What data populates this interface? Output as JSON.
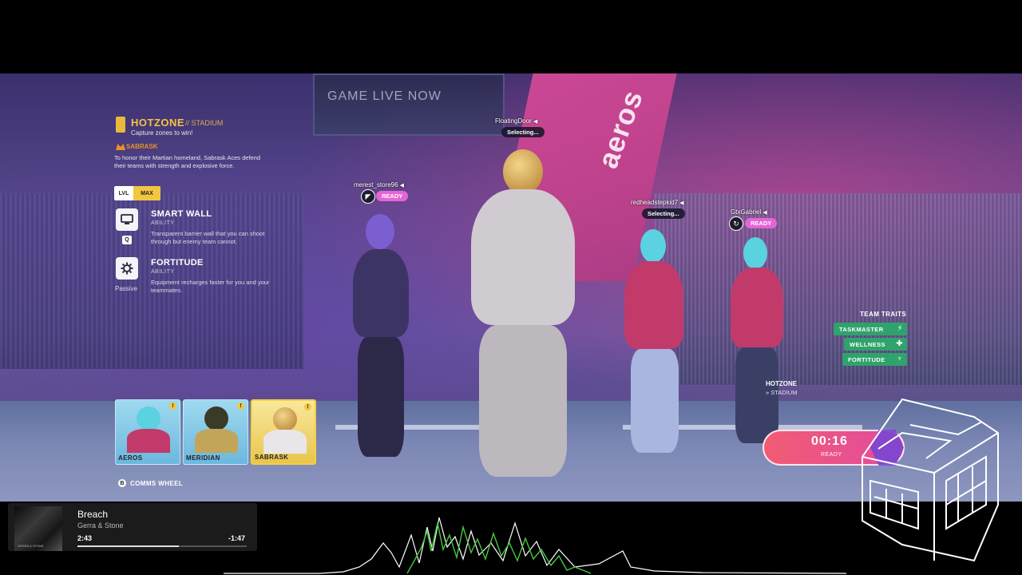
{
  "scene": {
    "banner_text": "GAME LIVE NOW",
    "aeros_text": "aeros"
  },
  "mode": {
    "title": "HOTZONE",
    "subtitle": "// STADIUM",
    "description": "Capture zones to win!"
  },
  "character": {
    "name": "SABRASK",
    "description": "To honor their Martian homeland, Sabrask Aces defend their teams with strength and explosive force.",
    "level_label": "LVL",
    "level_value": "MAX"
  },
  "abilities": [
    {
      "name": "SMART WALL",
      "type": "ABILITY",
      "description": "Transparent barrier wall that you can shoot through but enemy team cannot.",
      "key": "Q",
      "icon": "monitor-icon"
    },
    {
      "name": "FORTITUDE",
      "type": "ABILITY",
      "description": "Equipment recharges faster for you and your teammates.",
      "key": "Passive",
      "icon": "gear-icon"
    }
  ],
  "players": [
    {
      "name": "FloatingDoor",
      "status": "Selecting..."
    },
    {
      "name": "merest_store96",
      "status": "READY"
    },
    {
      "name": "redheadstepkid7",
      "status": "Selecting..."
    },
    {
      "name": "GtxGabriel",
      "status": "READY"
    }
  ],
  "team_traits": {
    "title": "TEAM TRAITS",
    "items": [
      "TASKMASTER",
      "WELLNESS",
      "FORTITUDE"
    ]
  },
  "map": {
    "mode": "HOTZONE",
    "location": "» STADIUM"
  },
  "timer": {
    "time": "00:16",
    "state": "READY"
  },
  "cards": [
    {
      "name": "AEROS",
      "alert": "!",
      "selected": false
    },
    {
      "name": "MERIDIAN",
      "alert": "!",
      "selected": false
    },
    {
      "name": "SABRASK",
      "alert": "!",
      "selected": true
    }
  ],
  "comms": {
    "key": "B",
    "label": "COMMS WHEEL"
  },
  "music": {
    "title": "Breach",
    "artist": "Gerra & Stone",
    "elapsed": "2:43",
    "remaining": "-1:47",
    "progress": 0.6,
    "album_text": "GERRA & STONE"
  },
  "colors": {
    "accent_yellow": "#f1c640",
    "ready_pink": "#e665d4",
    "trait_green": "#2fa36c",
    "timer_pink": "#e34aa0"
  }
}
